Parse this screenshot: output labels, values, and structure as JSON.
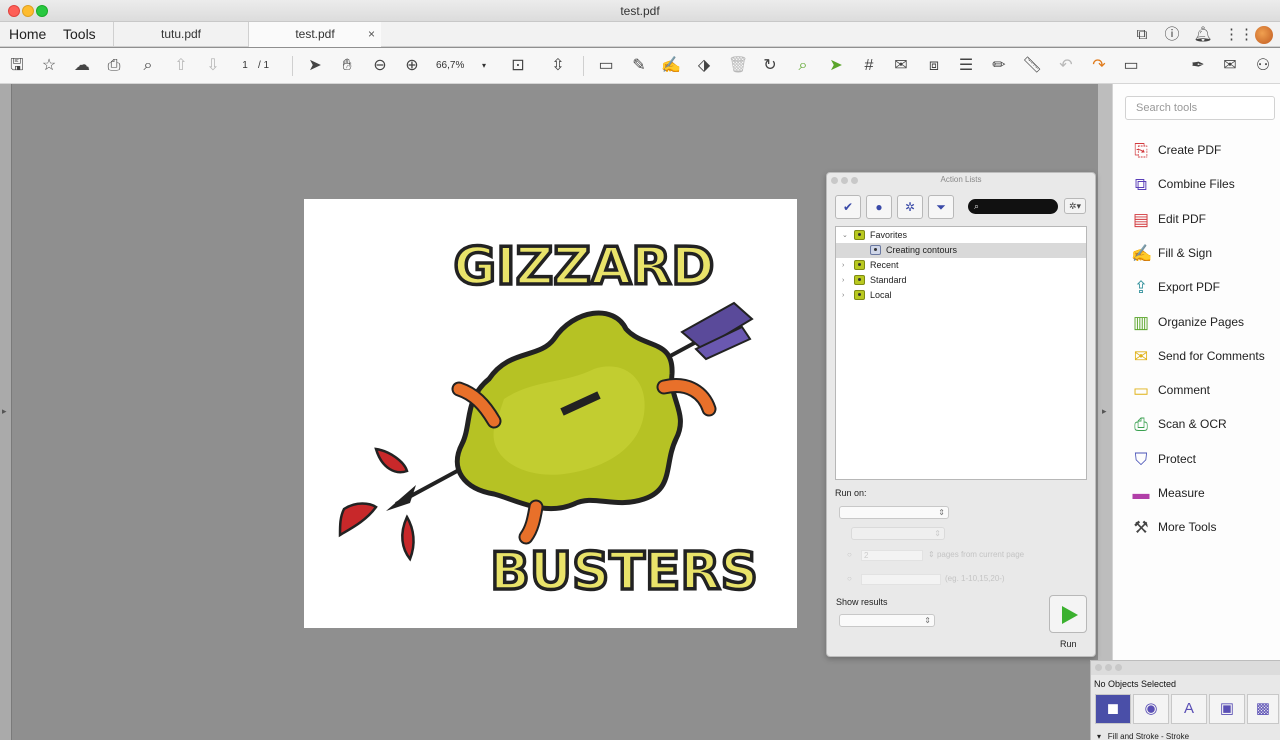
{
  "window": {
    "title": "test.pdf"
  },
  "nav": {
    "home": "Home",
    "tools": "Tools"
  },
  "tabs": [
    {
      "label": "tutu.pdf"
    },
    {
      "label": "test.pdf",
      "close": "×"
    }
  ],
  "toolbar": {
    "page_current": "1",
    "page_total": "/ 1",
    "zoom": "66,7%"
  },
  "tools_pane": {
    "search_placeholder": "Search tools",
    "items": [
      {
        "label": "Create PDF",
        "icon": "create-pdf-icon",
        "color": "#d2393d"
      },
      {
        "label": "Combine Files",
        "icon": "combine-files-icon",
        "color": "#5a3fb8"
      },
      {
        "label": "Edit PDF",
        "icon": "edit-pdf-icon",
        "color": "#d2393d"
      },
      {
        "label": "Fill & Sign",
        "icon": "fill-sign-icon",
        "color": "#6a4fc0"
      },
      {
        "label": "Export PDF",
        "icon": "export-pdf-icon",
        "color": "#2f8f9a"
      },
      {
        "label": "Organize Pages",
        "icon": "organize-pages-icon",
        "color": "#5aa52a"
      },
      {
        "label": "Send for Comments",
        "icon": "send-comments-icon",
        "color": "#e0b21a"
      },
      {
        "label": "Comment",
        "icon": "comment-icon",
        "color": "#e0b21a"
      },
      {
        "label": "Scan & OCR",
        "icon": "scan-ocr-icon",
        "color": "#3aa050"
      },
      {
        "label": "Protect",
        "icon": "protect-icon",
        "color": "#4a54b8"
      },
      {
        "label": "Measure",
        "icon": "measure-icon",
        "color": "#b13fa8"
      },
      {
        "label": "More Tools",
        "icon": "more-tools-icon",
        "color": "#444444"
      }
    ]
  },
  "action_panel": {
    "title": "Action Lists",
    "tree": [
      {
        "label": "Favorites",
        "expanded": true
      },
      {
        "label": "Creating contours",
        "child": true,
        "selected": true
      },
      {
        "label": "Recent"
      },
      {
        "label": "Standard"
      },
      {
        "label": "Local"
      }
    ],
    "run_on_label": "Run on:",
    "pages_value": "2",
    "pages_label": "pages from current page",
    "range_hint": "(eg. 1-10,15,20-)",
    "show_results_label": "Show results",
    "run_label": "Run"
  },
  "properties_panel": {
    "status": "No Objects Selected",
    "section": "Fill and Stroke - Stroke"
  },
  "document": {
    "art_top": "GIZZARD",
    "art_bottom": "BUSTERS"
  }
}
